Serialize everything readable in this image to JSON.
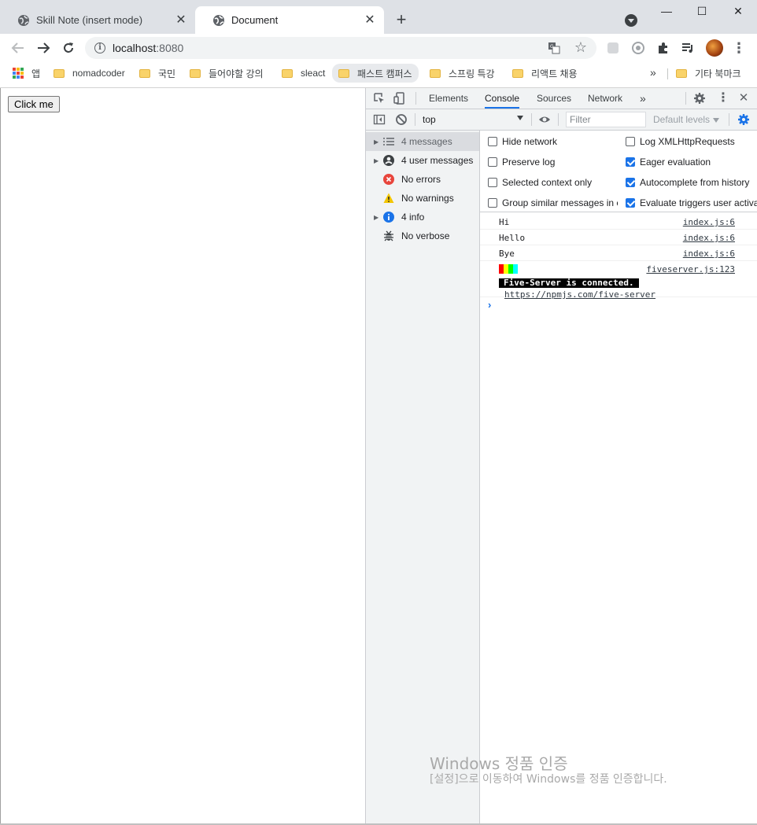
{
  "tabs": [
    {
      "title": "Skill Note (insert mode)",
      "close": "✕"
    },
    {
      "title": "Document",
      "close": "✕"
    }
  ],
  "new_tab": "+",
  "window_controls": {
    "minimize": "—",
    "maximize": "☐",
    "close": "✕"
  },
  "address": {
    "host": "localhost",
    "port": ":8080"
  },
  "bookmarks": {
    "apps": "앱",
    "items": [
      "nomadcoder",
      "국민",
      "들어야할 강의",
      "sleact",
      "패스트 캠퍼스",
      "스프링 특강",
      "리액트 채용"
    ],
    "more": "»",
    "other": "기타 북마크"
  },
  "page": {
    "button_label": "Click me"
  },
  "devtools": {
    "tabs": [
      "Elements",
      "Console",
      "Sources",
      "Network"
    ],
    "more_tabs": "»",
    "context": "top",
    "filter_placeholder": "Filter",
    "levels": "Default levels",
    "sidebar": [
      {
        "label": "4 messages",
        "icon": "list-icon",
        "expandable": true
      },
      {
        "label": "4 user messages",
        "icon": "user-icon",
        "expandable": true
      },
      {
        "label": "No errors",
        "icon": "error-icon",
        "expandable": false
      },
      {
        "label": "No warnings",
        "icon": "warning-icon",
        "expandable": false
      },
      {
        "label": "4 info",
        "icon": "info-icon",
        "expandable": true
      },
      {
        "label": "No verbose",
        "icon": "bug-icon",
        "expandable": false
      }
    ],
    "settings": {
      "left": [
        {
          "label": "Hide network",
          "checked": false
        },
        {
          "label": "Preserve log",
          "checked": false
        },
        {
          "label": "Selected context only",
          "checked": false
        },
        {
          "label": "Group similar messages in c",
          "checked": false
        }
      ],
      "right": [
        {
          "label": "Log XMLHttpRequests",
          "checked": false
        },
        {
          "label": "Eager evaluation",
          "checked": true
        },
        {
          "label": "Autocomplete from history",
          "checked": true
        },
        {
          "label": "Evaluate triggers user activa",
          "checked": true
        }
      ]
    },
    "logs": [
      {
        "message": "Hi",
        "source": "index.js:6"
      },
      {
        "message": "Hello",
        "source": "index.js:6"
      },
      {
        "message": "Bye",
        "source": "index.js:6"
      }
    ],
    "fiveserver": {
      "badge": "Five-Server is connected.",
      "link": "https://npmjs.com/five-server",
      "source": "fiveserver.js:123",
      "colors": [
        "#ff0000",
        "#ffff00",
        "#00ff00",
        "#00ffff"
      ]
    },
    "prompt": "›"
  },
  "watermark": {
    "title": "Windows 정품 인증",
    "subtitle": "[설정]으로 이동하여 Windows를 정품 인증합니다."
  },
  "colors": {
    "accent": "#1a73e8",
    "tabstrip": "#dee1e6",
    "devtools_panel": "#f1f3f4"
  }
}
